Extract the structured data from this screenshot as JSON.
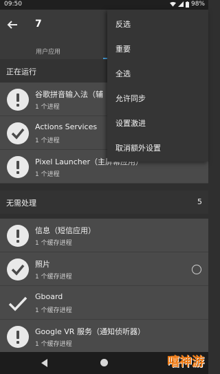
{
  "status_bar": {
    "time": "09:50",
    "battery": "98%"
  },
  "toolbar": {
    "title": "7"
  },
  "tabs": {
    "user_apps": "用户应用"
  },
  "running_section": {
    "label": "正在运行"
  },
  "running_apps": [
    {
      "name": "谷歌拼音输入法（辅",
      "sub": "1 个进程",
      "icon": "warning-icon"
    },
    {
      "name": "Actions Services",
      "sub": "1 个进程",
      "icon": "check-icon"
    },
    {
      "name": "Pixel Launcher（主屏幕应用）",
      "sub": "1 个进程",
      "icon": "warning-icon"
    }
  ],
  "no_action_section": {
    "label": "无需处理",
    "count": "5"
  },
  "no_action_apps": [
    {
      "name": "信息（短信应用）",
      "sub": "1 个缓存进程",
      "icon": "warning-icon"
    },
    {
      "name": "照片",
      "sub": "1 个缓存进程",
      "icon": "check-icon"
    },
    {
      "name": "Gboard",
      "sub": "1 个缓存进程",
      "icon": "plain-check-icon"
    },
    {
      "name": "Google VR 服务（通知侦听器）",
      "sub": "1 个缓存进程",
      "icon": "warning-icon"
    }
  ],
  "overflow_menu": {
    "items": [
      "反选",
      "重要",
      "全选",
      "允许同步",
      "设置激进",
      "取消额外设置"
    ]
  },
  "watermark": "嘻神游"
}
